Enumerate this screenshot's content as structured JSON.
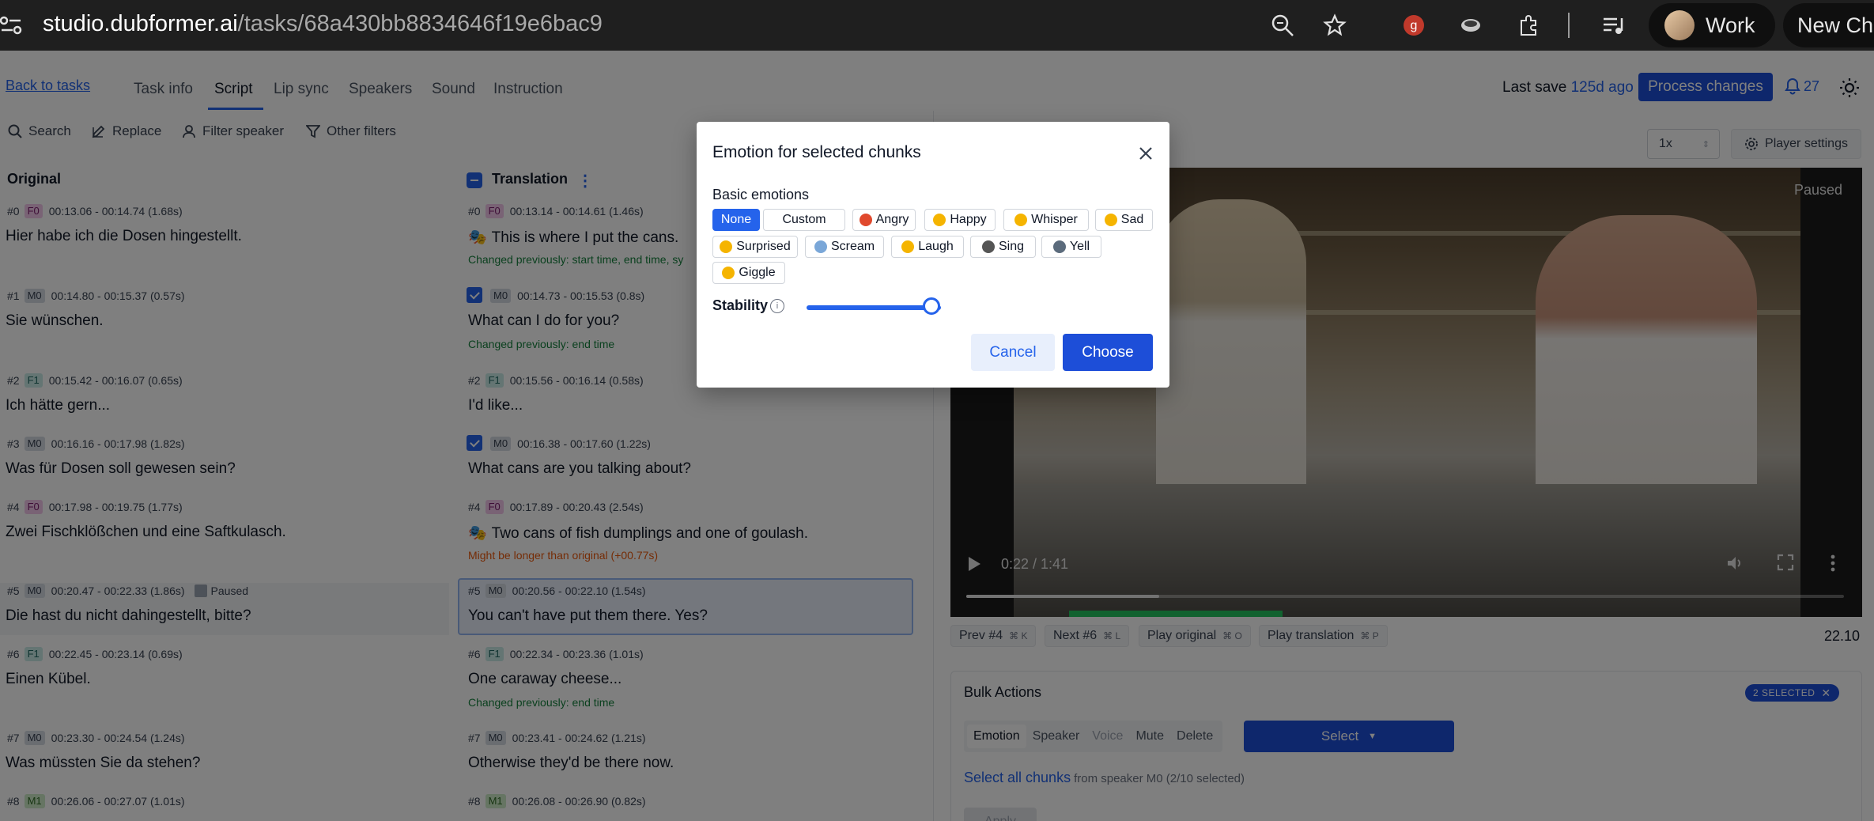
{
  "browser": {
    "url_host": "studio.dubformer.ai",
    "url_path": "/tasks/68a430bb8834646f19e6bac9",
    "profile_name": "Work",
    "new_chat_label": "New Ch"
  },
  "header": {
    "back_link": "Back to tasks",
    "tabs": [
      "Task info",
      "Script",
      "Lip sync",
      "Speakers",
      "Sound",
      "Instruction"
    ],
    "active_tab": "Script",
    "last_save_label": "Last save",
    "last_save_ago": "125d ago",
    "process_button": "Process changes",
    "notification_count": "27"
  },
  "toolbar": {
    "search": "Search",
    "replace": "Replace",
    "filter_speaker": "Filter speaker",
    "other_filters": "Other filters"
  },
  "columns": {
    "original": "Original",
    "translation": "Translation"
  },
  "segments": [
    {
      "num": "#0",
      "speaker": "F0",
      "orig_time": "00:13.06 - 00:14.74 (1.68s)",
      "orig_text": "Hier habe ich die Dosen hingestellt.",
      "trans_time": "00:13.14 - 00:14.61 (1.46s)",
      "trans_text": "This is where I put the cans.",
      "note": "Changed previously: start time, end time, sy",
      "note_type": "green",
      "checked": false,
      "emotion_mark": true
    },
    {
      "num": "#1",
      "speaker": "M0",
      "orig_time": "00:14.80 - 00:15.37 (0.57s)",
      "orig_text": "Sie wünschen.",
      "trans_time": "00:14.73 - 00:15.53 (0.8s)",
      "trans_text": "What can I do for you?",
      "note": "Changed previously: end time",
      "note_type": "green",
      "checked": true,
      "emotion_mark": false
    },
    {
      "num": "#2",
      "speaker": "F1",
      "orig_time": "00:15.42 - 00:16.07 (0.65s)",
      "orig_text": "Ich hätte gern...",
      "trans_time": "00:15.56 - 00:16.14 (0.58s)",
      "trans_text": "I'd like...",
      "note": "",
      "note_type": "",
      "checked": false,
      "emotion_mark": false
    },
    {
      "num": "#3",
      "speaker": "M0",
      "orig_time": "00:16.16 - 00:17.98 (1.82s)",
      "orig_text": "Was für Dosen soll gewesen sein?",
      "trans_time": "00:16.38 - 00:17.60 (1.22s)",
      "trans_text": "What cans are you talking about?",
      "note": "",
      "note_type": "",
      "checked": true,
      "emotion_mark": false
    },
    {
      "num": "#4",
      "speaker": "F0",
      "orig_time": "00:17.98 - 00:19.75 (1.77s)",
      "orig_text": "Zwei Fischklößchen und eine Saftkulasch.",
      "trans_time": "00:17.89 - 00:20.43 (2.54s)",
      "trans_text": "Two cans of fish dumplings and one of goulash.",
      "note": "Might be longer than original (+00.77s)",
      "note_type": "orange",
      "checked": false,
      "emotion_mark": true
    },
    {
      "num": "#5",
      "speaker": "M0",
      "orig_time": "00:20.47 - 00:22.33 (1.86s)",
      "orig_text": "Die hast du nicht dahingestellt, bitte?",
      "trans_time": "00:20.56 - 00:22.10 (1.54s)",
      "trans_text": "You can't have put them there. Yes?",
      "note": "",
      "note_type": "",
      "checked": false,
      "emotion_mark": false,
      "paused_label": "Paused"
    },
    {
      "num": "#6",
      "speaker": "F1",
      "orig_time": "00:22.45 - 00:23.14 (0.69s)",
      "orig_text": "Einen Kübel.",
      "trans_time": "00:22.34 - 00:23.36 (1.01s)",
      "trans_text": "One caraway cheese...",
      "note": "Changed previously: end time",
      "note_type": "green",
      "checked": false,
      "emotion_mark": false
    },
    {
      "num": "#7",
      "speaker": "M0",
      "orig_time": "00:23.30 - 00:24.54 (1.24s)",
      "orig_text": "Was müssten Sie da stehen?",
      "trans_time": "00:23.41 - 00:24.62 (1.21s)",
      "trans_text": "Otherwise they'd be there now.",
      "note": "",
      "note_type": "",
      "checked": false,
      "emotion_mark": false
    },
    {
      "num": "#8",
      "speaker": "M1",
      "orig_time": "00:26.06 - 00:27.07 (1.01s)",
      "orig_text": "",
      "trans_time": "00:26.08 - 00:26.90 (0.82s)",
      "trans_text": "",
      "note": "",
      "note_type": "",
      "checked": false,
      "emotion_mark": false
    }
  ],
  "player": {
    "speed": "1x",
    "settings_label": "Player settings",
    "status": "Paused",
    "time": "0:22 / 1:41",
    "progress": 0.22,
    "current_time": "22.10"
  },
  "segment_nav": {
    "prev": "Prev #4",
    "prev_kbd": "⌘ K",
    "next": "Next #6",
    "next_kbd": "⌘ L",
    "play_original": "Play original",
    "play_original_kbd": "⌘ O",
    "play_translation": "Play translation",
    "play_translation_kbd": "⌘ P"
  },
  "bulk": {
    "title": "Bulk Actions",
    "selected_badge": "2 SELECTED",
    "tabs": [
      "Emotion",
      "Speaker",
      "Voice",
      "Mute",
      "Delete"
    ],
    "active_tab": "Emotion",
    "disabled_tab": "Voice",
    "select_label": "Select",
    "select_all": "Select all chunks",
    "select_all_sub": "from speaker M0 (2/10 selected)",
    "apply": "Apply"
  },
  "modal": {
    "title": "Emotion for selected chunks",
    "basic_label": "Basic emotions",
    "emotions": [
      {
        "label": "None",
        "active": true,
        "icon": ""
      },
      {
        "label": "Custom",
        "active": false,
        "icon": ""
      },
      {
        "label": "Angry",
        "active": false,
        "icon": "angry-face-icon",
        "color": "#e0492d"
      },
      {
        "label": "Happy",
        "active": false,
        "icon": "happy-face-icon",
        "color": "#f5b400"
      },
      {
        "label": "Whisper",
        "active": false,
        "icon": "whisper-face-icon",
        "color": "#f5b400"
      },
      {
        "label": "Sad",
        "active": false,
        "icon": "sad-face-icon",
        "color": "#f5b400"
      },
      {
        "label": "Surprised",
        "active": false,
        "icon": "surprised-face-icon",
        "color": "#f5b400"
      },
      {
        "label": "Scream",
        "active": false,
        "icon": "scream-face-icon",
        "color": "#7aa7d8"
      },
      {
        "label": "Laugh",
        "active": false,
        "icon": "laugh-face-icon",
        "color": "#f5b400"
      },
      {
        "label": "Sing",
        "active": false,
        "icon": "microphone-icon",
        "color": "#555555"
      },
      {
        "label": "Yell",
        "active": false,
        "icon": "speaking-head-icon",
        "color": "#5b6b7c"
      },
      {
        "label": "Giggle",
        "active": false,
        "icon": "giggle-face-icon",
        "color": "#f5b400"
      }
    ],
    "stability_label": "Stability",
    "stability_value": 0.9,
    "cancel": "Cancel",
    "choose": "Choose"
  },
  "colors": {
    "accent": "#2563eb",
    "primary_button": "#1d4ed8",
    "note_green": "#15803d",
    "note_orange": "#ea580c"
  }
}
